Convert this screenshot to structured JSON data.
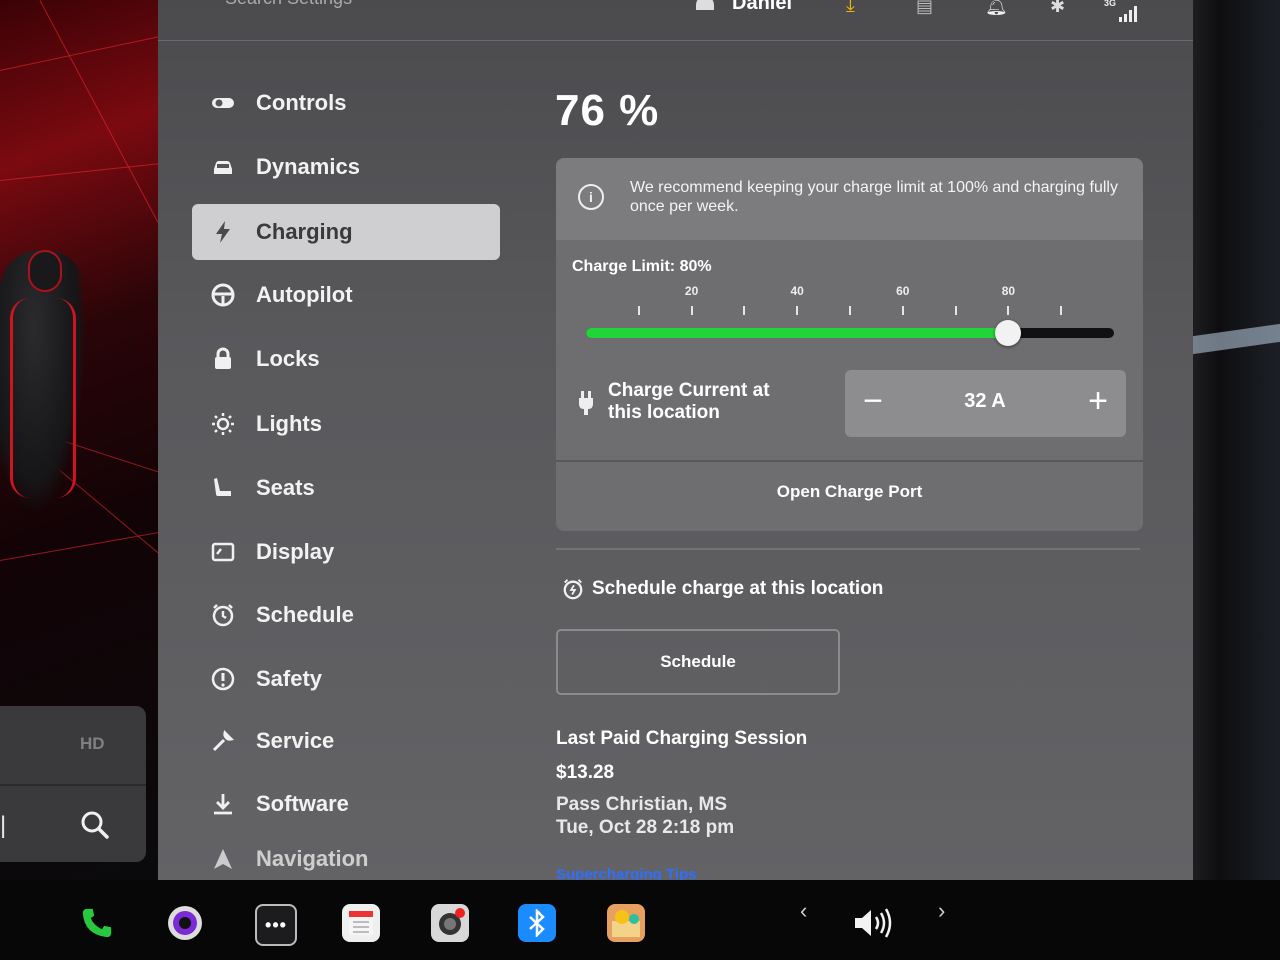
{
  "top_bar": {
    "search_text": "Search Settings",
    "user_name": "Daniel",
    "signal_label": "3G"
  },
  "sidebar": {
    "items": [
      {
        "label": "Controls",
        "icon": "toggle-icon"
      },
      {
        "label": "Dynamics",
        "icon": "car-icon"
      },
      {
        "label": "Charging",
        "icon": "lightning-icon",
        "active": true
      },
      {
        "label": "Autopilot",
        "icon": "steering-wheel-icon"
      },
      {
        "label": "Locks",
        "icon": "lock-icon"
      },
      {
        "label": "Lights",
        "icon": "light-bulb-icon"
      },
      {
        "label": "Seats",
        "icon": "seat-icon"
      },
      {
        "label": "Display",
        "icon": "display-icon"
      },
      {
        "label": "Schedule",
        "icon": "alarm-clock-icon"
      },
      {
        "label": "Safety",
        "icon": "alert-circle-icon"
      },
      {
        "label": "Service",
        "icon": "wrench-icon"
      },
      {
        "label": "Software",
        "icon": "download-icon"
      },
      {
        "label": "Navigation",
        "icon": "navigation-arrow-icon"
      }
    ]
  },
  "charging": {
    "battery_percent": "76 %",
    "recommendation": "We recommend keeping your charge limit at 100% and charging fully once per week.",
    "charge_limit_label": "Charge Limit: 80%",
    "charge_limit_value": 80,
    "tick_labels": [
      "20",
      "40",
      "60",
      "80"
    ],
    "charge_current_label": "Charge Current at this location",
    "charge_current_value": "32 A",
    "open_port_label": "Open Charge Port",
    "schedule_heading": "Schedule charge at this location",
    "schedule_button": "Schedule",
    "last_session_title": "Last Paid Charging Session",
    "last_session_amount": "$13.28",
    "last_session_location": "Pass Christian, MS",
    "last_session_date": "Tue, Oct 28 2:18 pm",
    "supercharging_link": "Supercharging Tips"
  },
  "media": {
    "hd_label": "HD"
  },
  "colors": {
    "slider_fill": "#21d43a",
    "active_item_bg": "#cfcfd2",
    "panel_bg": "#5a5a5d",
    "link_blue": "#2f6fff"
  }
}
